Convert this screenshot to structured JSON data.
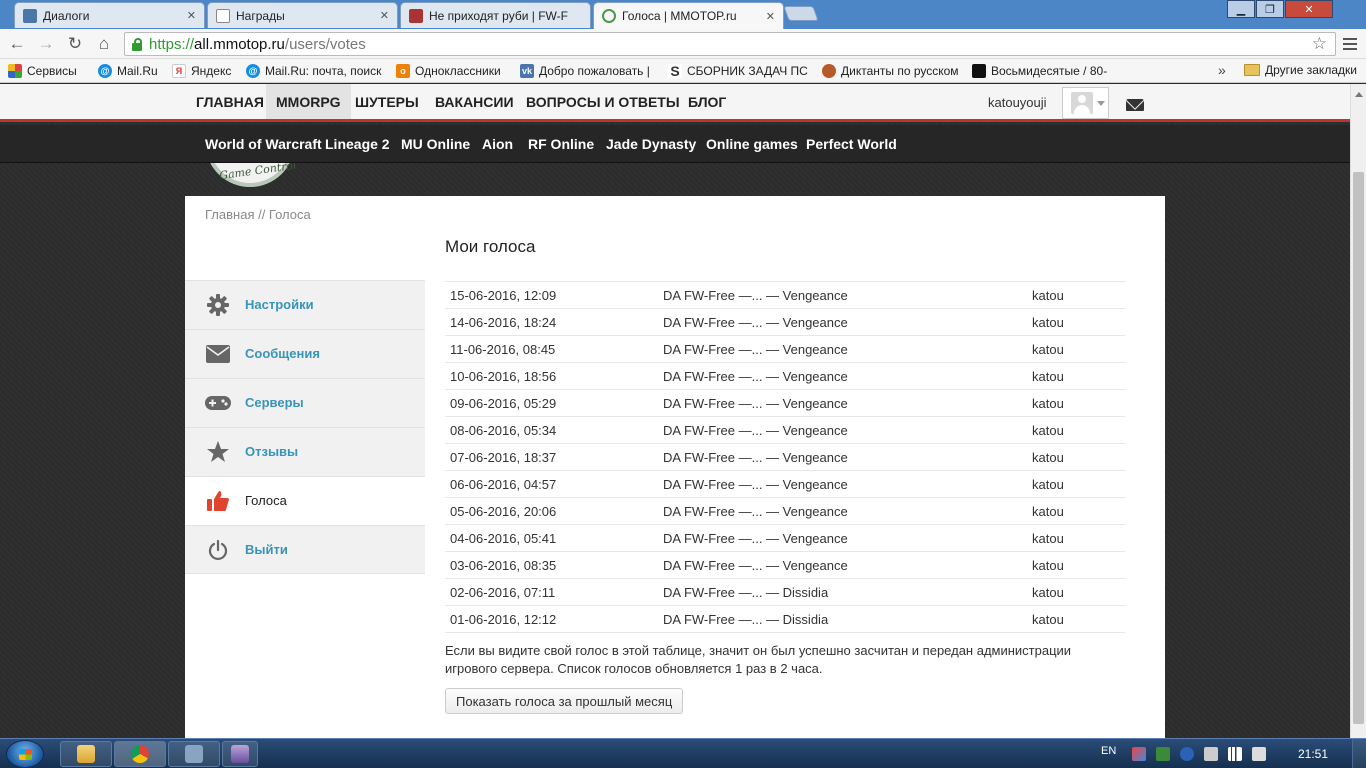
{
  "browser": {
    "tabs": [
      {
        "label": "Диалоги",
        "active": false
      },
      {
        "label": "Награды",
        "active": false
      },
      {
        "label": "Не приходят руби | FW-F",
        "active": false
      },
      {
        "label": "Голоса | MMOTOP.ru",
        "active": true
      }
    ],
    "tab_close": "✕",
    "url": {
      "scheme": "https://",
      "host": "all.mmotop.ru",
      "path": "/users/votes"
    },
    "bookmarks": [
      {
        "label": "Сервисы",
        "icon": "apps-grid-icon",
        "color": "#d44"
      },
      {
        "label": "Mail.Ru",
        "icon": "mailru-icon",
        "color": "#168de2"
      },
      {
        "label": "Яндекс",
        "icon": "yandex-icon",
        "color": "#e33"
      },
      {
        "label": "Mail.Ru: почта, поиск",
        "icon": "mailru-icon",
        "color": "#168de2"
      },
      {
        "label": "Одноклассники",
        "icon": "odnoklassniki-icon",
        "color": "#ee8208"
      },
      {
        "label": "Добро пожаловать |",
        "icon": "vk-icon",
        "color": "#4a76a8"
      },
      {
        "label": "СБОРНИК ЗАДАЧ ПС",
        "icon": "s-logo-icon",
        "color": "#333"
      },
      {
        "label": "Диктанты по русском",
        "icon": "kids-icon",
        "color": "#b65a2a"
      },
      {
        "label": "Восьмидесятые / 80-",
        "icon": "film-icon",
        "color": "#111"
      }
    ],
    "bookmarks_more": "»",
    "other_bookmarks": "Другие закладки"
  },
  "site": {
    "nav": [
      "ГЛАВНАЯ",
      "MMORPG",
      "ШУТЕРЫ",
      "ВАКАНСИИ",
      "ВОПРОСЫ И ОТВЕТЫ",
      "БЛОГ"
    ],
    "active_nav": "MMORPG",
    "username": "katouyouji",
    "subnav": [
      "World of Warcraft",
      "Lineage 2",
      "MU Online",
      "Aion",
      "RF Online",
      "Jade Dynasty",
      "Online games",
      "Perfect World"
    ],
    "logo_text": "Game Control"
  },
  "content": {
    "breadcrumb": "Главная // Голоса",
    "heading": "Мои голоса",
    "sidebar": [
      {
        "label": "Настройки",
        "icon": "gear-icon",
        "active": false
      },
      {
        "label": "Сообщения",
        "icon": "envelope-icon",
        "active": false
      },
      {
        "label": "Серверы",
        "icon": "gamepad-icon",
        "active": false
      },
      {
        "label": "Отзывы",
        "icon": "star-icon",
        "active": false
      },
      {
        "label": "Голоса",
        "icon": "thumbs-up-icon",
        "active": true
      },
      {
        "label": "Выйти",
        "icon": "power-icon",
        "active": false
      }
    ],
    "votes": [
      {
        "date": "15-06-2016, 12:09",
        "server": "DA FW-Free —... — Vengeance",
        "user": "katou"
      },
      {
        "date": "14-06-2016, 18:24",
        "server": "DA FW-Free —... — Vengeance",
        "user": "katou"
      },
      {
        "date": "11-06-2016, 08:45",
        "server": "DA FW-Free —... — Vengeance",
        "user": "katou"
      },
      {
        "date": "10-06-2016, 18:56",
        "server": "DA FW-Free —... — Vengeance",
        "user": "katou"
      },
      {
        "date": "09-06-2016, 05:29",
        "server": "DA FW-Free —... — Vengeance",
        "user": "katou"
      },
      {
        "date": "08-06-2016, 05:34",
        "server": "DA FW-Free —... — Vengeance",
        "user": "katou"
      },
      {
        "date": "07-06-2016, 18:37",
        "server": "DA FW-Free —... — Vengeance",
        "user": "katou"
      },
      {
        "date": "06-06-2016, 04:57",
        "server": "DA FW-Free —... — Vengeance",
        "user": "katou"
      },
      {
        "date": "05-06-2016, 20:06",
        "server": "DA FW-Free —... — Vengeance",
        "user": "katou"
      },
      {
        "date": "04-06-2016, 05:41",
        "server": "DA FW-Free —... — Vengeance",
        "user": "katou"
      },
      {
        "date": "03-06-2016, 08:35",
        "server": "DA FW-Free —... — Vengeance",
        "user": "katou"
      },
      {
        "date": "02-06-2016, 07:11",
        "server": "DA FW-Free —... — Dissidia",
        "user": "katou"
      },
      {
        "date": "01-06-2016, 12:12",
        "server": "DA FW-Free —... — Dissidia",
        "user": "katou"
      }
    ],
    "note": "Если вы видите свой голос в этой таблице, значит он был успешно засчитан и передан администрации игрового сервера. Список голосов обновляется 1 раз в 2 часа.",
    "prev_month_button": "Показать голоса за прошлый месяц"
  },
  "taskbar": {
    "lang": "EN",
    "clock": "21:51"
  },
  "colors": {
    "accent_red": "#b9362c",
    "link_blue": "#3894b8",
    "thumb_red": "#e0442f"
  }
}
